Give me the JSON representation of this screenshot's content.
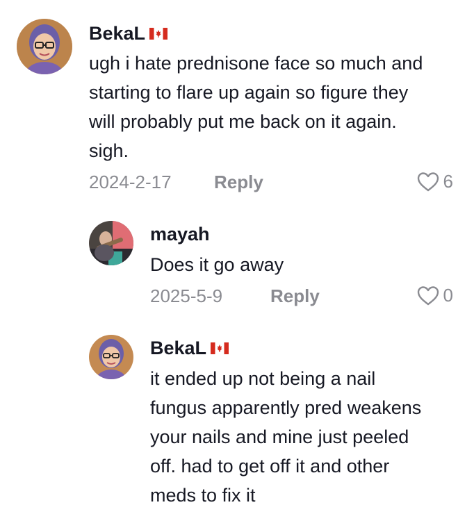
{
  "comments": [
    {
      "username": "BekaL",
      "flag": "canada-flag-icon",
      "text_lines": [
        "ugh i hate prednisone face so much and",
        "starting to flare up again so figure they",
        "will probably put me back on it again.",
        "sigh."
      ],
      "date": "2024-2-17",
      "reply_label": "Reply",
      "likes": "6"
    },
    {
      "username": "mayah",
      "text_lines": [
        "Does it go away"
      ],
      "date": "2025-5-9",
      "reply_label": "Reply",
      "likes": "0"
    },
    {
      "username": "BekaL",
      "flag": "canada-flag-icon",
      "text_lines": [
        "it ended up not being a nail",
        "fungus apparently pred weakens",
        "your nails and mine just peeled",
        "off. had to get off it and other",
        "meds to fix it"
      ]
    }
  ],
  "colors": {
    "primary_text": "#161823",
    "secondary_text": "#8a8b91",
    "flag_red": "#d52b1e"
  }
}
